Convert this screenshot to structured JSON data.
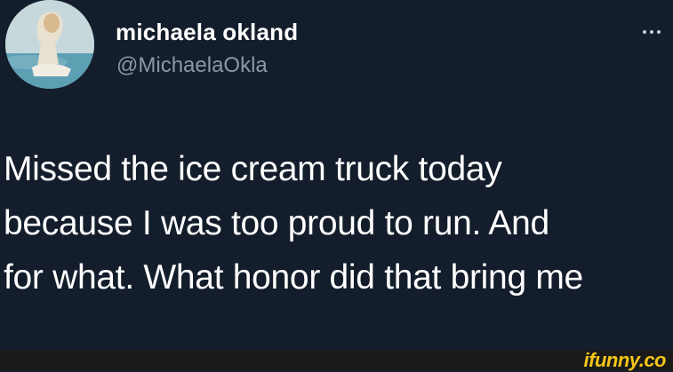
{
  "tweet": {
    "author": {
      "display_name": "michaela okland",
      "handle": "@MichaelaOkla",
      "avatar_icon": "profile-photo"
    },
    "more_icon": "ellipsis-icon",
    "text_lines": [
      "Missed the ice cream truck today",
      "because I was too proud to run. And",
      "for what. What honor did that bring me"
    ]
  },
  "watermark": {
    "text": "ifunny.co",
    "color": "#f5c518"
  },
  "colors": {
    "background": "#141d2b",
    "text": "#ffffff",
    "handle": "#8b98a5"
  }
}
